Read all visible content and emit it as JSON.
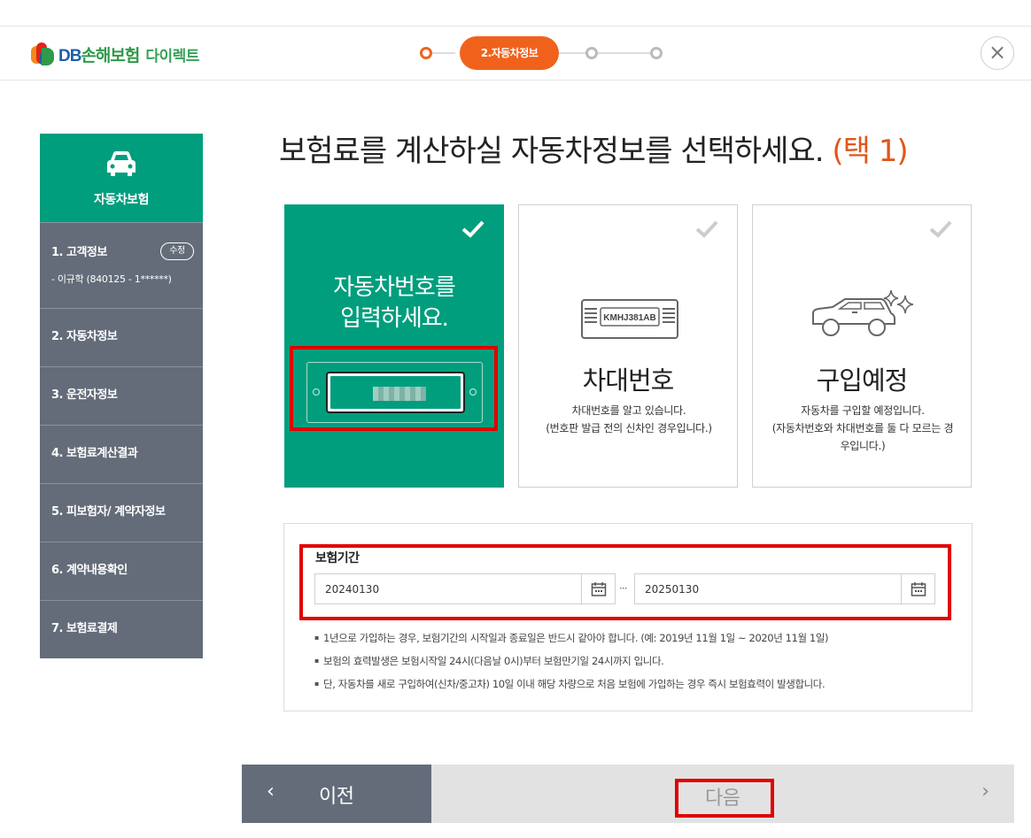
{
  "header": {
    "logo_brand": "DB손해보험",
    "logo_brand_db": "DB",
    "logo_brand_rest": "손해보험",
    "logo_sub": "다이렉트",
    "current_step": "2.자동차정보",
    "close_icon": "×"
  },
  "sidebar": {
    "head_icon": "car-icon",
    "head_title": "자동차보험",
    "items": [
      {
        "label": "1. 고객정보",
        "sub": "- 이규학 (840125 - 1******)",
        "badge": "수정"
      },
      {
        "label": "2. 자동차정보"
      },
      {
        "label": "3. 운전자정보"
      },
      {
        "label": "4. 보험료계산결과"
      },
      {
        "label": "5. 피보험자/ 계약자정보"
      },
      {
        "label": "6. 계약내용확인"
      },
      {
        "label": "7. 보험료결제"
      }
    ]
  },
  "main": {
    "title": "보험료를 계산하실 자동차정보를 선택하세요.",
    "title_note": "(택 1)",
    "cards": [
      {
        "line1": "자동차번호를",
        "line2": "입력하세요.",
        "selected": true
      },
      {
        "heading": "차대번호",
        "plate_text": "KMHJ381AB",
        "desc1": "차대번호를 알고 있습니다.",
        "desc2": "(번호판 발급 전의 신차인 경우입니다.)"
      },
      {
        "heading": "구입예정",
        "desc1": "자동차를 구입할 예정입니다.",
        "desc2": "(자동차번호와 차대번호를 둘 다 모르는 경우입니다.)"
      }
    ],
    "period": {
      "label": "보험기간",
      "start": "20240130",
      "end": "20250130",
      "separator": "···",
      "notes": [
        "1년으로 가입하는 경우, 보험기간의 시작일과 종료일은 반드시 같아야 합니다. (예: 2019년 11월 1일 ~ 2020년 11월 1일)",
        "보험의 효력발생은 보험시작일 24시(다음날 0시)부터 보험만기일 24시까지 입니다.",
        "단, 자동차를 새로 구입하여(신차/중고차) 10일 이내 해당 차량으로 처음 보험에 가입하는 경우 즉시 보험효력이 발생합니다."
      ]
    }
  },
  "footer": {
    "prev_label": "이전",
    "next_label": "다음",
    "prev_arrow": "‹",
    "next_arrow": "›"
  },
  "colors": {
    "accent_green": "#009e7d",
    "step_orange": "#f0621c",
    "sidebar_gray": "#646c79",
    "highlight_red": "#e00000"
  }
}
